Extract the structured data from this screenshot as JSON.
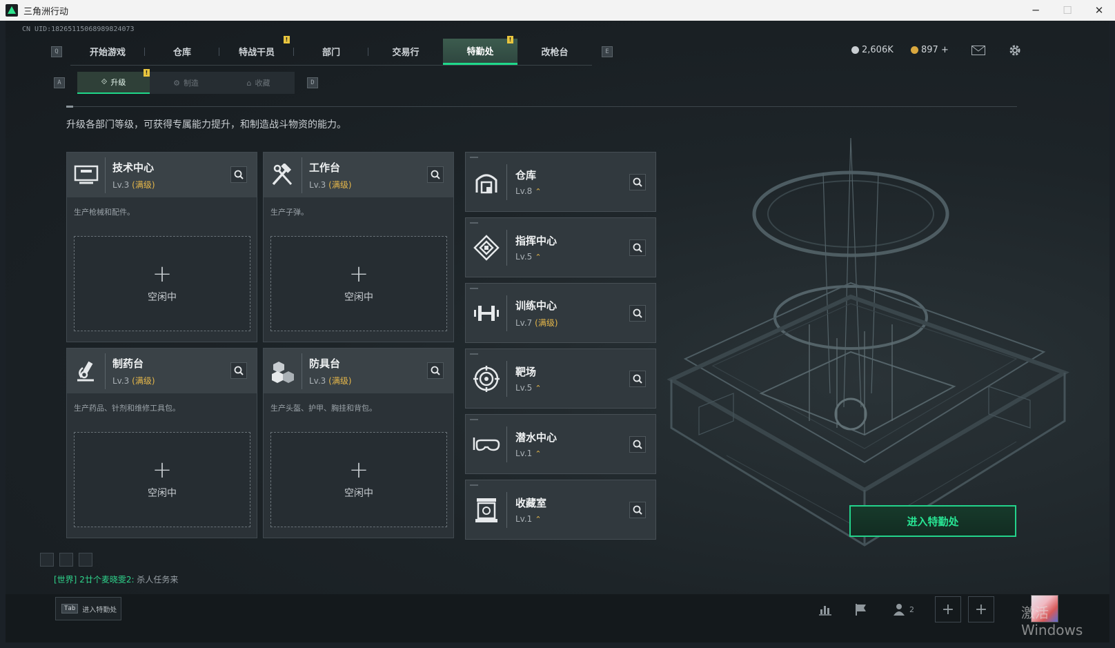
{
  "window": {
    "title": "三角洲行动",
    "minimize": "─",
    "maximize": "☐",
    "close": "✕"
  },
  "uid": "CN UID:18265115068989824073",
  "topnav": {
    "left_key": "Q",
    "right_key": "E",
    "tabs": [
      {
        "label": "开始游戏",
        "active": false,
        "badge": false
      },
      {
        "label": "仓库",
        "active": false,
        "badge": false
      },
      {
        "label": "特战干员",
        "active": false,
        "badge": true
      },
      {
        "label": "部门",
        "active": false,
        "badge": false
      },
      {
        "label": "交易行",
        "active": false,
        "badge": false
      },
      {
        "label": "特勤处",
        "active": true,
        "badge": true
      },
      {
        "label": "改枪台",
        "active": false,
        "badge": false
      }
    ],
    "badge_text": "!"
  },
  "currency": {
    "silver": "2,606K",
    "gold": "897 +"
  },
  "subnav": {
    "left_key": "A",
    "right_key": "D",
    "tabs": [
      {
        "label": "升级",
        "icon": "⟐",
        "active": true
      },
      {
        "label": "制造",
        "icon": "⚙",
        "active": false
      },
      {
        "label": "收藏",
        "icon": "⌂",
        "active": false
      }
    ],
    "badge_text": "!"
  },
  "description": "升级各部门等级，可获得专属能力提升，和制造战斗物资的能力。",
  "production": [
    {
      "name": "技术中心",
      "level": "Lv.3",
      "max": "(满级)",
      "desc": "生产枪械和配件。",
      "slot_plus": "+",
      "slot_label": "空闲中"
    },
    {
      "name": "工作台",
      "level": "Lv.3",
      "max": "(满级)",
      "desc": "生产子弹。",
      "slot_plus": "+",
      "slot_label": "空闲中"
    },
    {
      "name": "制药台",
      "level": "Lv.3",
      "max": "(满级)",
      "desc": "生产药品、针剂和维修工具包。",
      "slot_plus": "+",
      "slot_label": "空闲中"
    },
    {
      "name": "防具台",
      "level": "Lv.3",
      "max": "(满级)",
      "desc": "生产头盔、护甲、胸挂和背包。",
      "slot_plus": "+",
      "slot_label": "空闲中"
    }
  ],
  "facilities": [
    {
      "name": "仓库",
      "level": "Lv.8",
      "max": "",
      "up": "⌃"
    },
    {
      "name": "指挥中心",
      "level": "Lv.5",
      "max": "",
      "up": "⌃"
    },
    {
      "name": "训练中心",
      "level": "Lv.7",
      "max": "(满级)",
      "up": ""
    },
    {
      "name": "靶场",
      "level": "Lv.5",
      "max": "",
      "up": "⌃"
    },
    {
      "name": "潜水中心",
      "level": "Lv.1",
      "max": "",
      "up": "⌃"
    },
    {
      "name": "收藏室",
      "level": "Lv.1",
      "max": "",
      "up": "⌃"
    }
  ],
  "enter_button": "进入特勤处",
  "chat": {
    "channel": "[世界]",
    "user": "2廿个麦晓雯2:",
    "message": "杀人任务来"
  },
  "bottom": {
    "tab_key": "Tab",
    "tab_label": "进入特勤处",
    "friends_count": "2",
    "watermark": "激活 Windows"
  },
  "colors": {
    "accent": "#1fd88a",
    "gold": "#e7b84a"
  }
}
